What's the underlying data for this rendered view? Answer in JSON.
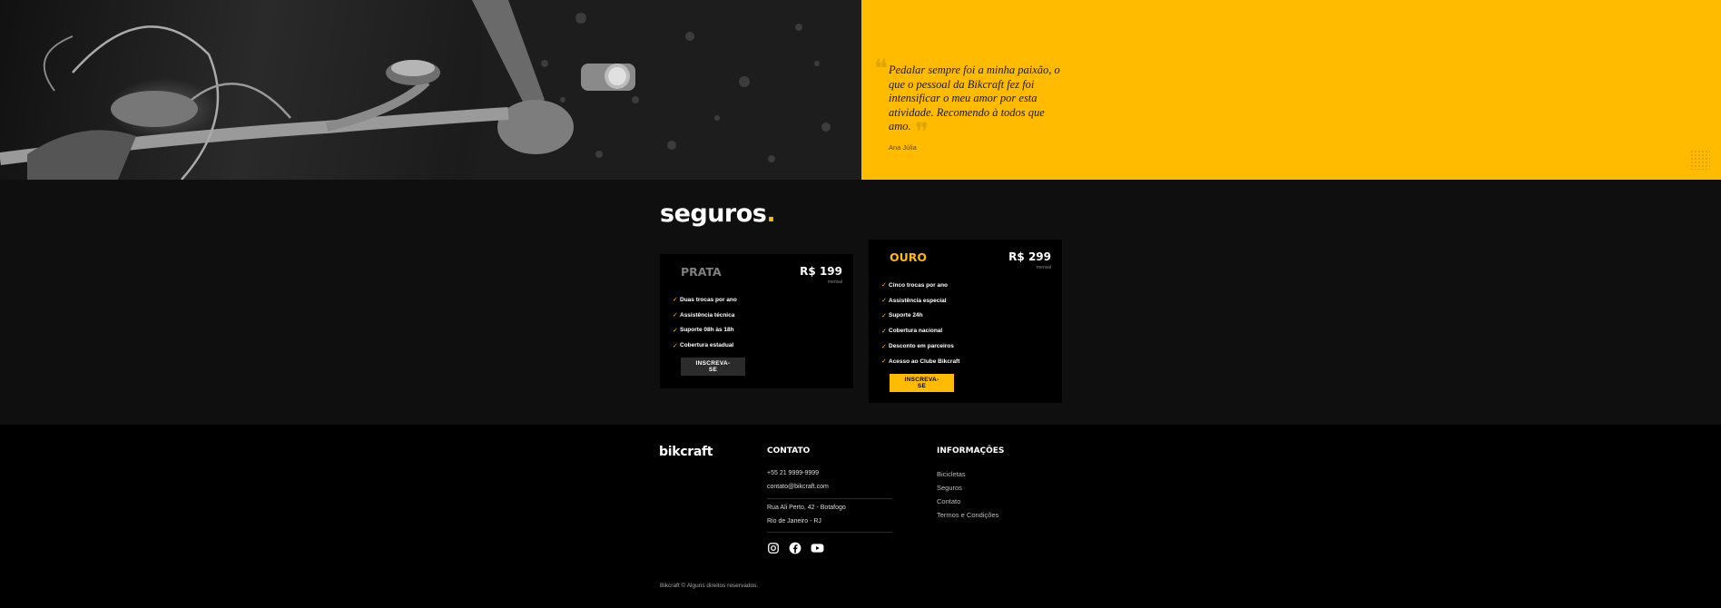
{
  "testimonial": {
    "quote": "Pedalar sempre foi a minha paixão, o que o pessoal da Bikcraft fez foi intensificar o meu amor por esta atividade. Recomendo à todos que amo.",
    "author": "Ana Júlia",
    "accent_color": "#ffbb00"
  },
  "seguros": {
    "title": "seguros",
    "title_dot": ".",
    "plans": [
      {
        "name": "PRATA",
        "price": "R$ 199",
        "period": "mensal",
        "features": [
          "Duas trocas por ano",
          "Assistência técnica",
          "Suporte 08h às 18h",
          "Cobertura estadual"
        ],
        "button": "INSCREVA-SE"
      },
      {
        "name": "OURO",
        "price": "R$ 299",
        "period": "mensal",
        "features": [
          "Cinco trocas por ano",
          "Assistência especial",
          "Suporte 24h",
          "Cobertura nacional",
          "Desconto em parceiros",
          "Acesso ao Clube Bikcraft"
        ],
        "button": "INSCREVA-SE"
      }
    ]
  },
  "footer": {
    "brand": "bikcraft",
    "contato": {
      "heading": "CONTATO",
      "phone": "+55 21 9999-9999",
      "email": "contato@bikcraft.com",
      "address_line1": "Rua Ali Perto, 42 - Botafogo",
      "address_line2": "Rio de Janeiro - RJ"
    },
    "social_icons": [
      "instagram-icon",
      "facebook-icon",
      "youtube-icon"
    ],
    "informacoes": {
      "heading": "INFORMAÇÕES",
      "links": [
        "Bicicletas",
        "Seguros",
        "Contato",
        "Termos e Condições"
      ]
    },
    "copyright": "Bikcraft © Alguns direitos reservados."
  }
}
